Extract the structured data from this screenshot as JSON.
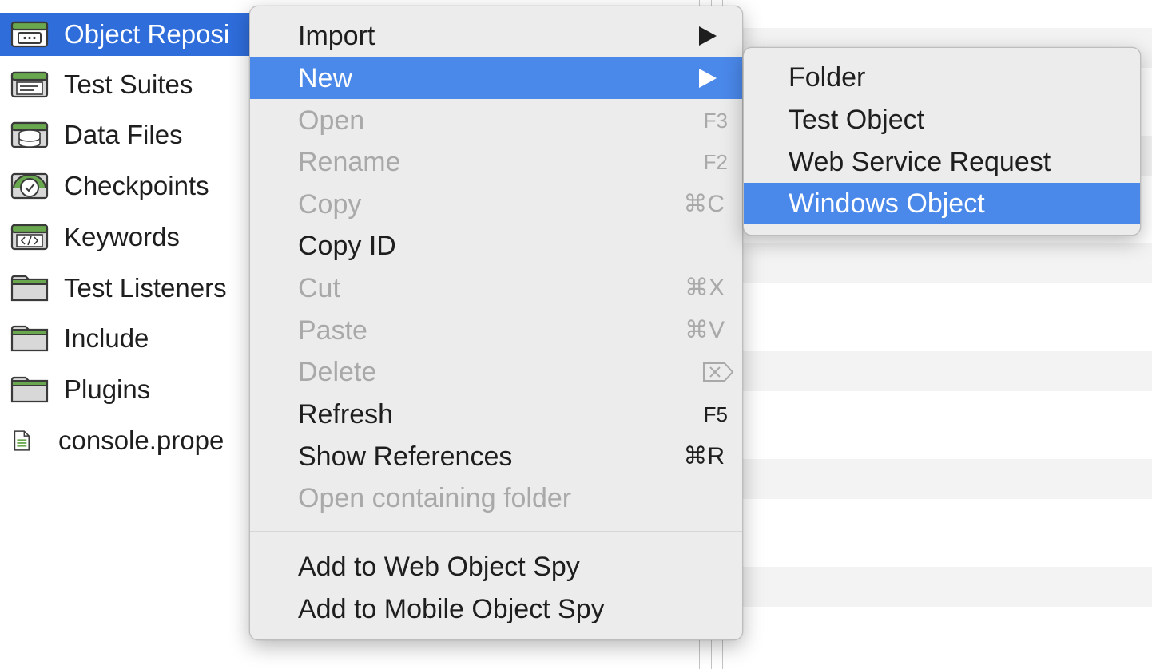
{
  "tree": {
    "items": [
      {
        "label": "Object Reposi",
        "icon": "object-repository-icon",
        "selected": true
      },
      {
        "label": "Test Suites",
        "icon": "test-suites-icon"
      },
      {
        "label": "Data Files",
        "icon": "data-files-icon"
      },
      {
        "label": "Checkpoints",
        "icon": "checkpoints-icon"
      },
      {
        "label": "Keywords",
        "icon": "keywords-icon"
      },
      {
        "label": "Test Listeners",
        "icon": "folder-icon"
      },
      {
        "label": "Include",
        "icon": "folder-icon"
      },
      {
        "label": "Plugins",
        "icon": "folder-icon"
      },
      {
        "label": "console.prope",
        "icon": "text-file-icon"
      }
    ]
  },
  "context_menu": {
    "items": [
      {
        "label": "Import",
        "submenu": true
      },
      {
        "label": "New",
        "submenu": true,
        "highlighted": true
      },
      {
        "label": "Open",
        "shortcut": "F3",
        "disabled": true
      },
      {
        "label": "Rename",
        "shortcut": "F2",
        "disabled": true
      },
      {
        "label": "Copy",
        "shortcut": "⌘C",
        "disabled": true
      },
      {
        "label": "Copy ID"
      },
      {
        "label": "Cut",
        "shortcut": "⌘X",
        "disabled": true
      },
      {
        "label": "Paste",
        "shortcut": "⌘V",
        "disabled": true
      },
      {
        "label": "Delete",
        "shortcut_icon": "delete-key-icon",
        "disabled": true
      },
      {
        "label": "Refresh",
        "shortcut": "F5"
      },
      {
        "label": "Show References",
        "shortcut": "⌘R"
      },
      {
        "label": "Open containing folder",
        "disabled": true
      },
      {
        "label": "Add to Web Object Spy"
      },
      {
        "label": "Add to Mobile Object Spy"
      }
    ]
  },
  "new_submenu": {
    "items": [
      {
        "label": "Folder"
      },
      {
        "label": "Test Object"
      },
      {
        "label": "Web Service Request"
      },
      {
        "label": "Windows Object",
        "highlighted": true
      }
    ]
  },
  "colors": {
    "selection": "#2f6ddb",
    "menu_highlight": "#4a88ea",
    "menu_background": "#ececec",
    "disabled_text": "#a9a9a9",
    "icon_green": "#6aa84f"
  }
}
